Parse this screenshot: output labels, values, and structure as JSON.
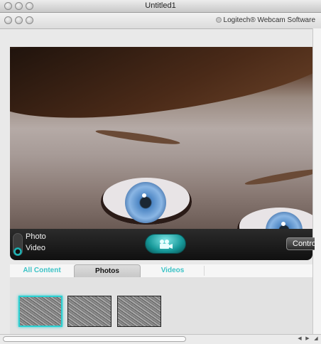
{
  "window": {
    "title": "Untitled1"
  },
  "app": {
    "brand": "Logitech® Webcam Software"
  },
  "capture": {
    "mode_photo_label": "Photo",
    "mode_video_label": "Video",
    "selected_mode": "Video",
    "controls_label": "Controls"
  },
  "tabs": [
    {
      "label": "All Content",
      "active": false
    },
    {
      "label": "Photos",
      "active": true
    },
    {
      "label": "Videos",
      "active": false
    }
  ],
  "thumbnails": [
    {
      "selected": true
    },
    {
      "selected": false
    },
    {
      "selected": false
    }
  ],
  "colors": {
    "accent": "#2bd0d2",
    "bar": "#101010"
  }
}
